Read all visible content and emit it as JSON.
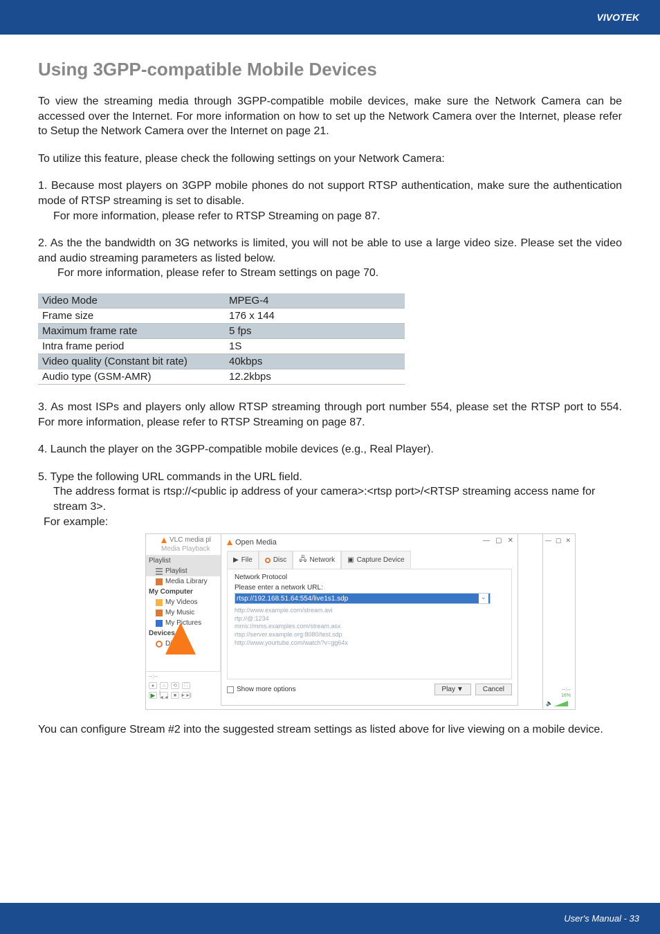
{
  "header": {
    "brand": "VIVOTEK"
  },
  "title": "Using 3GPP-compatible Mobile Devices",
  "p1": "To view the streaming media through 3GPP-compatible mobile devices, make sure the Network Camera can be accessed over the Internet. For more information on how to set up the Network Camera over the Internet, please refer to Setup the Network Camera over the Internet on page 21.",
  "p2": "To utilize this feature, please check the following settings on your Network Camera:",
  "i1_main": "1. Because most players on 3GPP mobile phones do not support RTSP authentication, make sure the authentication mode of RTSP streaming is set to disable.",
  "i1_sub": "For more information, please refer to RTSP Streaming on page 87.",
  "i2_main": "2. As the the bandwidth on 3G networks is limited, you will not be able to use a large video size. Please set the video and audio streaming parameters as listed below.",
  "i2_sub": "For more information, please refer to Stream settings on page 70.",
  "table": [
    {
      "k": "Video Mode",
      "v": "MPEG-4"
    },
    {
      "k": "Frame size",
      "v": "176 x 144"
    },
    {
      "k": "Maximum frame rate",
      "v": "5 fps"
    },
    {
      "k": "Intra frame period",
      "v": "1S"
    },
    {
      "k": "Video quality (Constant bit rate)",
      "v": "40kbps"
    },
    {
      "k": "Audio type (GSM-AMR)",
      "v": "12.2kbps"
    }
  ],
  "i3": "3. As most ISPs and players only allow RTSP streaming through port number 554, please set the RTSP port to 554. For more information, please refer to RTSP Streaming on page 87.",
  "i4": "4. Launch the player on the 3GPP-compatible mobile devices (e.g., Real Player).",
  "i5_main": "5. Type the following URL commands in the URL field.",
  "i5_sub1": "The address format is rtsp://<public ip address of your camera>:<rtsp port>/<RTSP streaming access name for stream 3>.",
  "i5_sub2": "For example:",
  "vlc": {
    "title": "VLC media pl",
    "menu": "Media   Playback",
    "sidebar_hdr1": "Playlist",
    "side_playlist": "Playlist",
    "side_library": "Media Library",
    "sidebar_hdr2": "My Computer",
    "side_videos": "My Videos",
    "side_music": "My Music",
    "side_pictures": "My Pictures",
    "sidebar_hdr3": "Devices",
    "side_discs": "Discs",
    "time": "--:--",
    "ctrl_play": "▶",
    "ctrl_prev": "|◄◄",
    "ctrl_stop": "■",
    "ctrl_next": "►►|",
    "open_title": "Open Media",
    "tab_file": "File",
    "tab_disc": "Disc",
    "tab_network": "Network",
    "tab_capture": "Capture Device",
    "np_hdr": "Network Protocol",
    "np_label": "Please enter a network URL:",
    "np_url": "rtsp://192.168.51.64:554/live1s1.sdp",
    "np_ex1": "http://www.example.com/stream.avi",
    "np_ex2": "rtp://@:1234",
    "np_ex3": "mms://mms.examples.com/stream.asx",
    "np_ex4": "rtsp://server.example.org:8080/test.sdp",
    "np_ex5": "http://www.yourtube.com/watch?v=gg64x",
    "show_more": "Show more options",
    "btn_play": "Play",
    "btn_cancel": "Cancel",
    "vol": "16%",
    "time2": "--:--"
  },
  "p_last": "You can configure Stream #2 into the suggested stream settings as listed above for live viewing on a mobile device.",
  "footer": {
    "text": "User's Manual - 33"
  }
}
